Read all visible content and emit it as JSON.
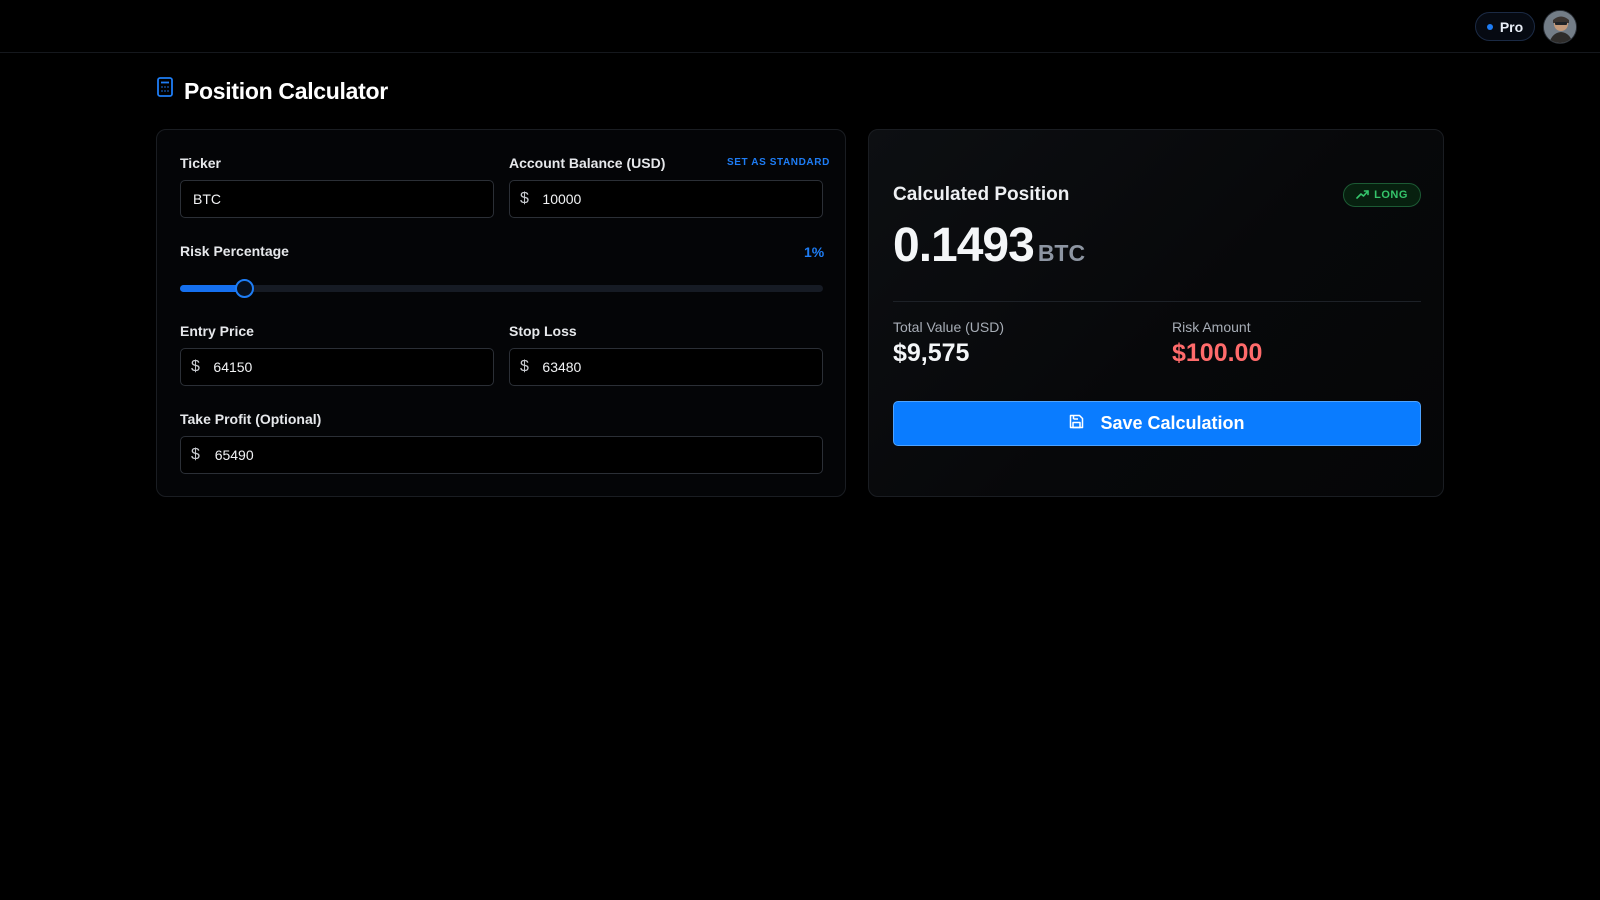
{
  "header": {
    "plan_badge": "Pro",
    "avatar_icon": "user-avatar"
  },
  "page": {
    "title": "Position Calculator",
    "title_icon": "calculator-icon"
  },
  "form": {
    "ticker": {
      "label": "Ticker",
      "value": "BTC"
    },
    "account_balance": {
      "label": "Account Balance (USD)",
      "currency_symbol": "$",
      "value": "10000",
      "action_label": "SET AS STANDARD"
    },
    "risk_percentage": {
      "label": "Risk Percentage",
      "value_label": "1%",
      "slider_fraction": 0.1
    },
    "entry_price": {
      "label": "Entry Price",
      "currency_symbol": "$",
      "value": "64150"
    },
    "stop_loss": {
      "label": "Stop Loss",
      "currency_symbol": "$",
      "value": "63480"
    },
    "take_profit": {
      "label": "Take Profit (Optional)",
      "currency_symbol": "$",
      "value": "65490"
    }
  },
  "result": {
    "title": "Calculated Position",
    "direction_badge": "LONG",
    "direction_icon": "trending-up-icon",
    "position_size": "0.1493",
    "position_unit": "BTC",
    "total_value_label": "Total Value (USD)",
    "total_value": "$9,575",
    "risk_amount_label": "Risk Amount",
    "risk_amount": "$100.00",
    "save_button_label": "Save Calculation",
    "save_icon": "save-icon"
  },
  "colors": {
    "background": "#000000",
    "accent_blue": "#0a7cff",
    "long_green": "#35c56b",
    "risk_red": "#ff6b6b"
  }
}
